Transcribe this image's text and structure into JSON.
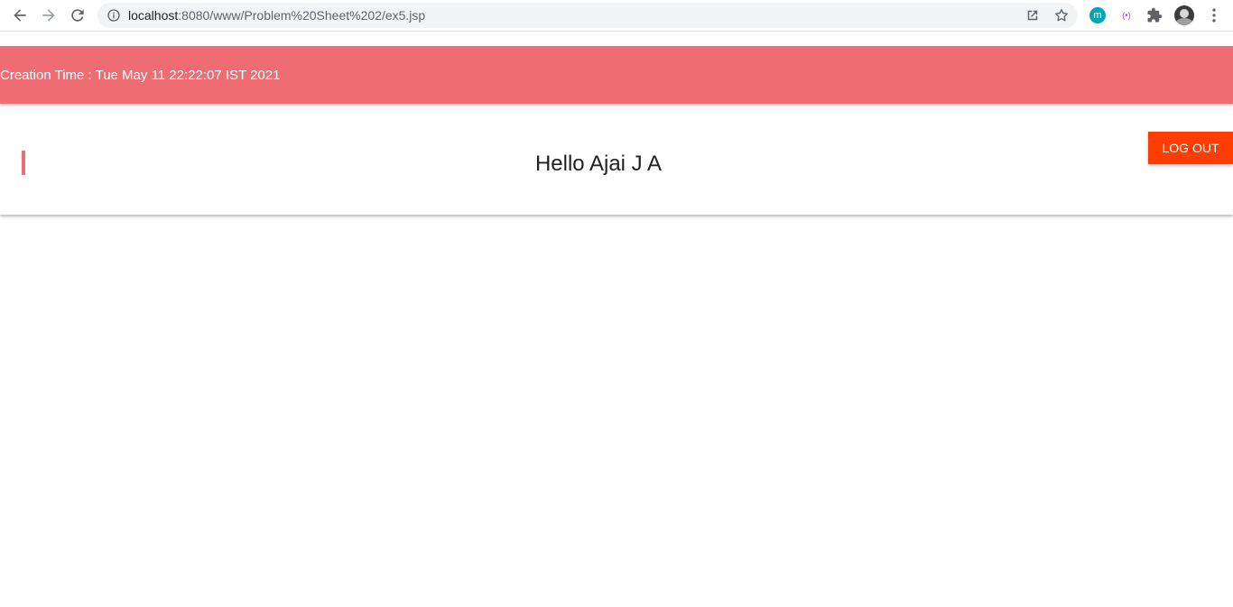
{
  "browser": {
    "url_host": "localhost",
    "url_rest": ":8080/www/Problem%20Sheet%202/ex5.jsp",
    "extension_m_label": "m",
    "extension_broadcast_label": "(•)"
  },
  "page": {
    "banner_text": "Creation Time : Tue May 11 22:22:07 IST 2021",
    "greeting": "Hello Ajai J A",
    "logout_label": "LOG OUT"
  },
  "colors": {
    "banner": "#ef6c73",
    "accent": "#ef6c73",
    "logout": "#ff3d00"
  }
}
